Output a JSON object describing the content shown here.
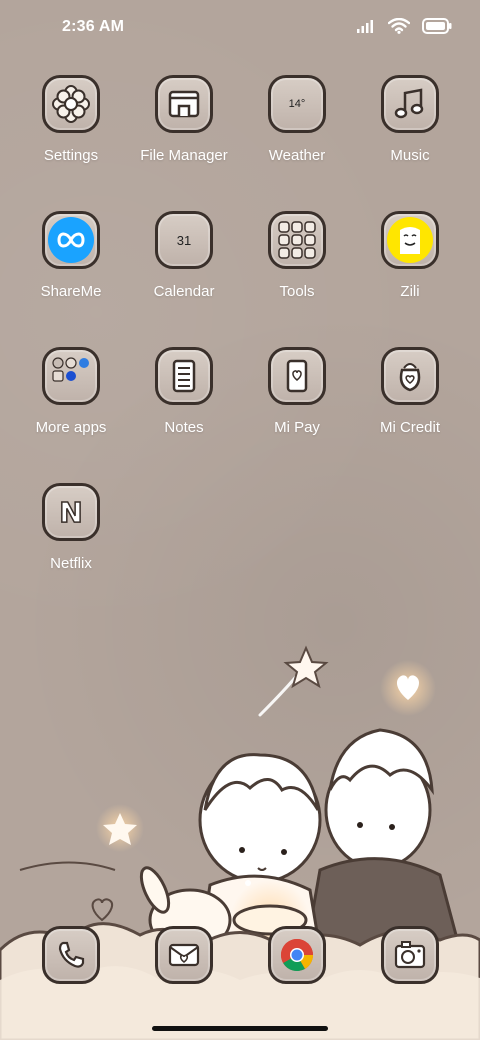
{
  "status_bar": {
    "time": "2:36 AM"
  },
  "apps": [
    {
      "label": "Settings",
      "icon": "flower-gear-icon"
    },
    {
      "label": "File Manager",
      "icon": "folder-icon"
    },
    {
      "label": "Weather",
      "icon": "weather-icon",
      "badge_text": "14°"
    },
    {
      "label": "Music",
      "icon": "music-note-icon"
    },
    {
      "label": "ShareMe",
      "icon": "shareme-icon"
    },
    {
      "label": "Calendar",
      "icon": "calendar-icon",
      "badge_text": "31"
    },
    {
      "label": "Tools",
      "icon": "tools-folder-icon"
    },
    {
      "label": "Zili",
      "icon": "zili-icon"
    },
    {
      "label": "More apps",
      "icon": "more-apps-folder-icon"
    },
    {
      "label": "Notes",
      "icon": "notes-icon"
    },
    {
      "label": "Mi Pay",
      "icon": "mi-pay-icon"
    },
    {
      "label": "Mi Credit",
      "icon": "mi-credit-icon"
    },
    {
      "label": "Netflix",
      "icon": "netflix-icon",
      "badge_text": "N"
    }
  ],
  "dock": [
    {
      "name": "phone",
      "icon": "phone-icon"
    },
    {
      "name": "messages",
      "icon": "envelope-heart-icon"
    },
    {
      "name": "chrome",
      "icon": "chrome-icon"
    },
    {
      "name": "camera",
      "icon": "camera-icon"
    }
  ],
  "colors": {
    "wallpaper": "#b3a59c",
    "icon_border": "#3a302b",
    "shareme_blue": "#1aa3ff",
    "zili_yellow": "#ffe600"
  }
}
